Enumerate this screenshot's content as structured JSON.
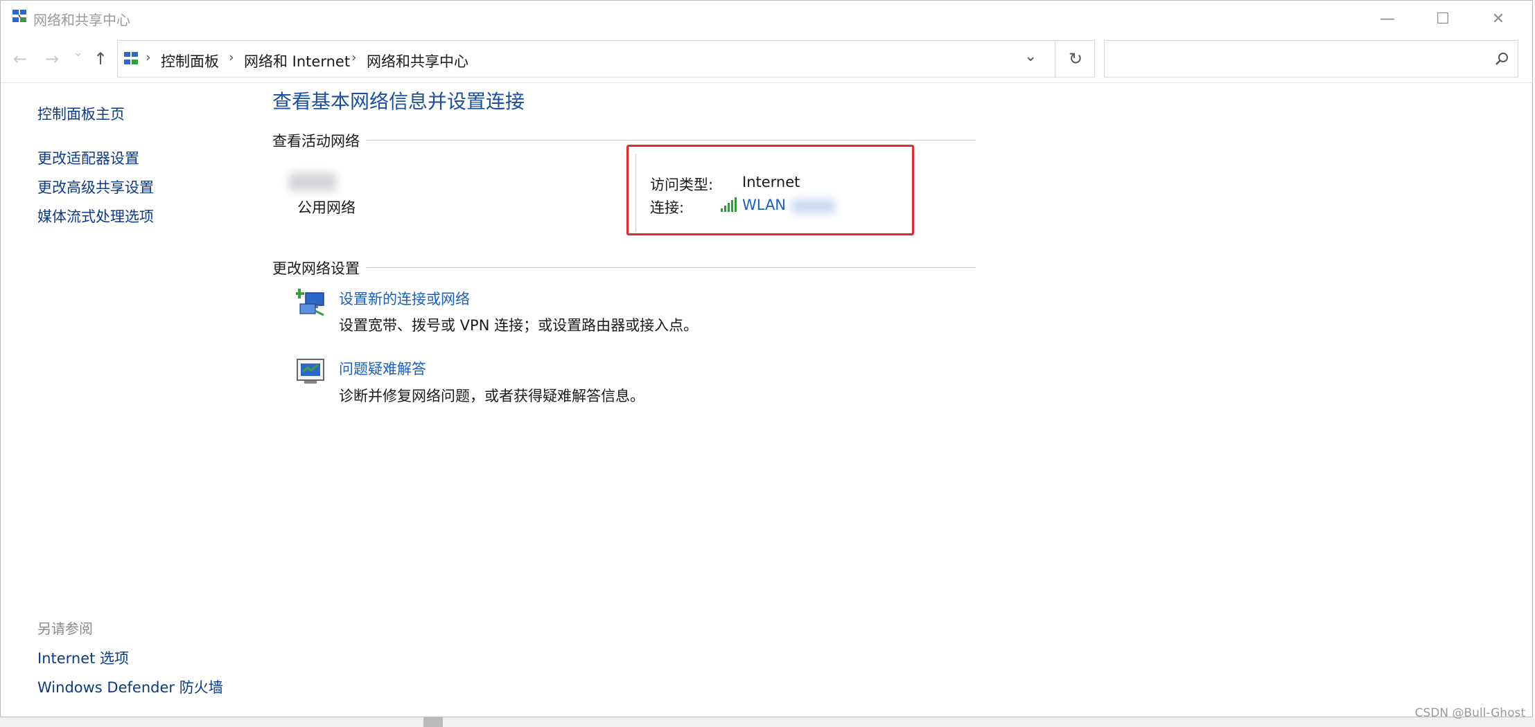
{
  "window": {
    "title": "网络和共享中心",
    "minimize_glyph": "—",
    "maximize_glyph": "☐",
    "close_glyph": "✕"
  },
  "nav": {
    "back_glyph": "←",
    "forward_glyph": "→",
    "recent_glyph": "⌄",
    "up_glyph": "↑",
    "breadcrumb": [
      "控制面板",
      "网络和 Internet",
      "网络和共享中心"
    ],
    "separator": "›",
    "dropdown_glyph": "⌄",
    "refresh_glyph": "↻",
    "search_placeholder": "",
    "search_icon": "search-icon"
  },
  "sidebar": {
    "home": "控制面板主页",
    "links": [
      "更改适配器设置",
      "更改高级共享设置",
      "媒体流式处理选项"
    ],
    "see_also_title": "另请参阅",
    "see_also": [
      "Internet 选项",
      "Windows Defender 防火墙"
    ]
  },
  "main": {
    "title": "查看基本网络信息并设置连接",
    "active_networks_header": "查看活动网络",
    "network_type": "公用网络",
    "access_type_label": "访问类型:",
    "access_type_value": "Internet",
    "connection_label": "连接:",
    "connection_value": "WLAN",
    "change_settings_header": "更改网络设置",
    "tasks": [
      {
        "link": "设置新的连接或网络",
        "desc": "设置宽带、拨号或 VPN 连接；或设置路由器或接入点。",
        "icon": "new-connection-icon"
      },
      {
        "link": "问题疑难解答",
        "desc": "诊断并修复网络问题，或者获得疑难解答信息。",
        "icon": "troubleshoot-icon"
      }
    ]
  },
  "watermark": "CSDN @Bull-Ghost",
  "colors": {
    "link": "#1a5fbf",
    "title": "#1a4ea2",
    "highlight": "#e8272a",
    "signal": "#2e9e3a"
  }
}
